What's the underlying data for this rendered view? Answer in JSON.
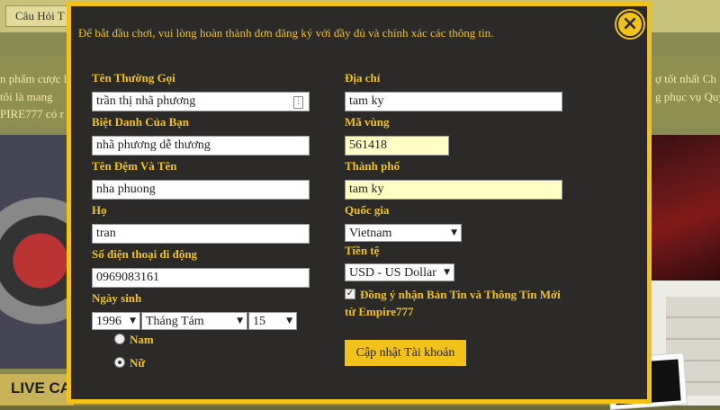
{
  "background": {
    "tab_label": "Câu Hỏi T",
    "left_lines": [
      "n phẩm cược l",
      "tôi là mang",
      "PIRE777 có r"
    ],
    "right_lines": [
      "ợ tốt nhất Ch",
      "g phục vụ Quy"
    ],
    "live_label": "LIVE CA"
  },
  "modal": {
    "intro": "Để bắt đầu chơi, vui lòng hoàn thành đơn đăng ký với đầy đủ và chính xác các thông tin.",
    "close_icon": "×"
  },
  "form": {
    "nickname_label": "Tên Thường Gọi",
    "nickname_value": "trần thị nhã phương",
    "alias_label": "Biệt Danh Của Bạn",
    "alias_value": "nhã phương dễ thương",
    "middle_first_label": "Tên Đệm Và Tên",
    "middle_first_value": "nha phuong",
    "last_label": "Họ",
    "last_value": "tran",
    "phone_label": "Số điện thoại di động",
    "phone_value": "0969083161",
    "birth_label": "Ngày sinh",
    "birth_year": "1996",
    "birth_month": "Tháng Tám",
    "birth_day": "15",
    "gender_male": "Nam",
    "gender_female": "Nữ",
    "gender_selected": "Nữ",
    "address_label": "Địa chỉ",
    "address_value": "tam ky",
    "zip_label": "Mã vùng",
    "zip_value": "561418",
    "city_label": "Thành phố",
    "city_value": "tam ky",
    "country_label": "Quốc gia",
    "country_value": "Vietnam",
    "currency_label": "Tiền tệ",
    "currency_value": "USD - US Dollar",
    "newsletter_line1": "Đồng ý nhận Bản Tin và Thông Tin Mới",
    "newsletter_line2": "từ Empire777",
    "newsletter_checked": true,
    "submit_label": "Cập nhật Tài khoản"
  },
  "colors": {
    "accent": "#f2c21a",
    "modal_bg": "#2b2a28",
    "autofill_bg": "#fdfdc4"
  }
}
